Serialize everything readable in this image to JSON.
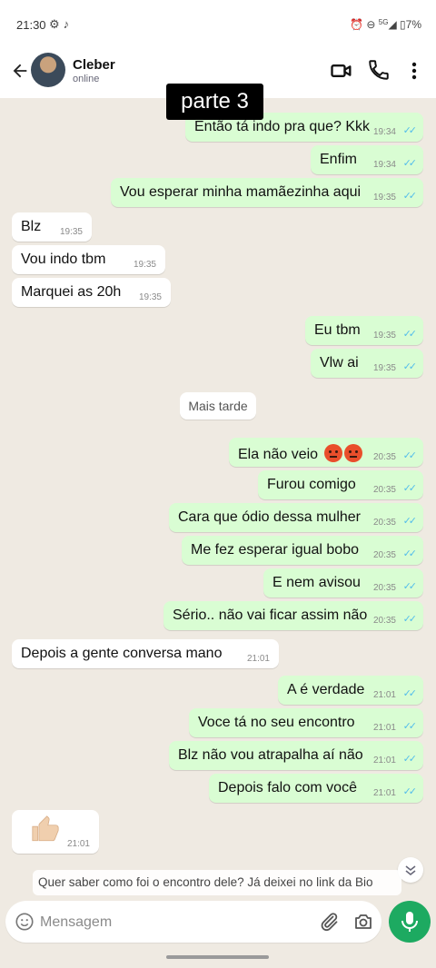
{
  "status_bar": {
    "time": "21:30",
    "battery": "7%",
    "network": "5G",
    "left_icons": [
      "settings-icon",
      "tiktok-icon"
    ],
    "right_icons": [
      "alarm-icon",
      "dnd-icon",
      "signal-icon",
      "battery-icon"
    ]
  },
  "header": {
    "contact_name": "Cleber",
    "contact_status": "online"
  },
  "overlay_title": "parte 3",
  "messages": [
    {
      "dir": "out",
      "text": "Então tá indo pra que? Kkk",
      "time": "19:34"
    },
    {
      "dir": "out",
      "text": "Enfim",
      "time": "19:34"
    },
    {
      "dir": "out",
      "text": "Vou esperar minha mamãezinha aqui",
      "time": "19:35"
    },
    {
      "dir": "in",
      "text": "Blz",
      "time": "19:35"
    },
    {
      "dir": "in",
      "text": "Vou indo tbm",
      "time": "19:35"
    },
    {
      "dir": "in",
      "text": "Marquei as 20h",
      "time": "19:35"
    },
    {
      "dir": "out",
      "text": "Eu tbm",
      "time": "19:35"
    },
    {
      "dir": "out",
      "text": "Vlw ai",
      "time": "19:35"
    },
    {
      "dir": "out",
      "text": "Ela não veio",
      "time": "20:35"
    },
    {
      "dir": "out",
      "text": "Furou comigo",
      "time": "20:35"
    },
    {
      "dir": "out",
      "text": "Cara que ódio dessa mulher",
      "time": "20:35"
    },
    {
      "dir": "out",
      "text": "Me fez esperar igual bobo",
      "time": "20:35"
    },
    {
      "dir": "out",
      "text": "E nem avisou",
      "time": "20:35"
    },
    {
      "dir": "out",
      "text": "Sério.. não vai ficar assim não",
      "time": "20:35"
    },
    {
      "dir": "in",
      "text": "Depois a gente conversa mano",
      "time": "21:01"
    },
    {
      "dir": "out",
      "text": "A é verdade",
      "time": "21:01"
    },
    {
      "dir": "out",
      "text": "Voce tá no seu encontro",
      "time": "21:01"
    },
    {
      "dir": "out",
      "text": "Blz não vou atrapalha aí não",
      "time": "21:01"
    },
    {
      "dir": "out",
      "text": "Depois falo com você",
      "time": "21:01"
    },
    {
      "dir": "in",
      "text": "",
      "time": "21:01",
      "sticker": "thumbs-up-icon"
    }
  ],
  "system_message": "Mais tarde",
  "caption_banner": "Quer saber como foi o encontro dele? Já deixei no link da Bio",
  "input": {
    "placeholder": "Mensagem",
    "value": ""
  },
  "colors": {
    "outgoing_bubble": "#d9fdd3",
    "incoming_bubble": "#ffffff",
    "chat_background": "#efeae2",
    "read_check": "#53bdeb",
    "mic_button": "#1daa61"
  }
}
